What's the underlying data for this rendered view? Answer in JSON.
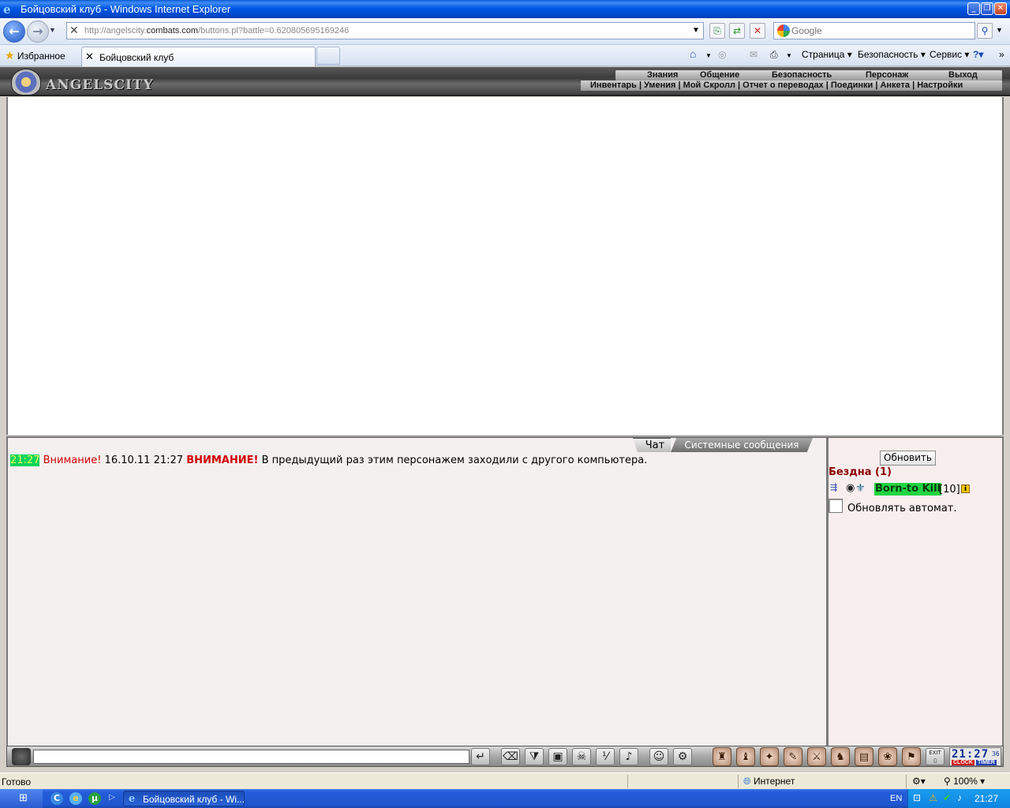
{
  "window": {
    "title": "Бойцовский клуб - Windows Internet Explorer"
  },
  "browser": {
    "url_gray1": "http://angelscity.",
    "url_dark": "combats.com",
    "url_gray2": "/buttons.pl?battle=0.620805695169246",
    "search_placeholder": "Google",
    "favorites_label": "Избранное",
    "tab_title": "Бойцовский клуб",
    "cmd_page": "Страница",
    "cmd_security": "Безопасность",
    "cmd_service": "Сервис",
    "status_text": "Готово",
    "zone_text": "Интернет",
    "zoom_text": "100%"
  },
  "game": {
    "logo_text": "ANGELSCITY",
    "menu_top": [
      "Знания",
      "Общение",
      "Безопасность",
      "Персонаж",
      "Выход"
    ],
    "menu_sub": "Инвентарь | Умения | Мой Скролл | Отчет о переводах | Поединки | Анкета | Настройки",
    "chat_tab": "Чат",
    "system_tab": "Системные сообщения",
    "chat_time": "21:27",
    "chat_warn": "Внимание!",
    "chat_date": " 16.10.11 21:27 ",
    "chat_warn2": "ВНИМАНИЕ!",
    "chat_text": " В предыдущий раз этим персонажем заходили с другого компьютера.",
    "refresh_label": "Обновить",
    "location": "Бездна (1)",
    "player_name": "Born-to Kill",
    "player_level": "[10]",
    "auto_refresh_label": "Обновлять автомат.",
    "clock_digits": "21:27",
    "clock_seconds": "36",
    "clock_label": "CLOCK",
    "timer_label": "TIMER",
    "exit_label": "EXIT"
  },
  "taskbar": {
    "task_label": "Бойцовский клуб - Wi...",
    "lang": "EN",
    "time": "21:27"
  }
}
